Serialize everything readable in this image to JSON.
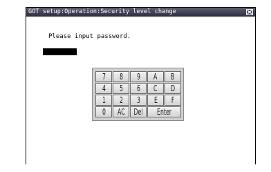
{
  "window": {
    "title": "GOT setup:Operation:Security level change",
    "prompt": "Please input password.",
    "password_value": ""
  },
  "keypad": {
    "rows": [
      [
        "7",
        "8",
        "9",
        "A",
        "B"
      ],
      [
        "4",
        "5",
        "6",
        "C",
        "D"
      ],
      [
        "1",
        "2",
        "3",
        "E",
        "F"
      ],
      [
        "0",
        "AC",
        "Del",
        "Enter"
      ]
    ]
  },
  "colors": {
    "titlebar_top": "#5e5e72",
    "titlebar_bottom": "#2c2c3e",
    "password_field": "#000000",
    "keypad_bg": "#cfcfcf"
  }
}
